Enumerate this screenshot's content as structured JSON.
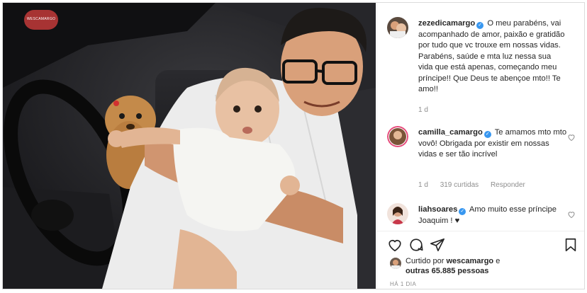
{
  "post": {
    "author": "zezedicamargo",
    "caption": "O meu parabéns, vai acompanhado de amor, paixão e gratidão por tudo que vc trouxe em nossas vidas. Parabéns, saúde e mta luz nessa sua vida que está apenas, começando meu príncipe!! Que Deus te abençoe mto!! Te amo!!",
    "age": "1 d",
    "photo_sticker": "WESCAMARGO"
  },
  "comments": [
    {
      "username": "camilla_camargo",
      "text": "Te amamos mto mto vovô! Obrigada por existir em nossas vidas e ser tão incrível",
      "age": "1 d",
      "likes": "319 curtidas",
      "reply": "Responder"
    },
    {
      "username": "liahsoares",
      "text": "Amo muito esse príncipe Joaquim ! ♥"
    }
  ],
  "likes": {
    "prefix": "Curtido por",
    "user": "wescamargo",
    "conj": "e",
    "others": "outras 65.885 pessoas"
  },
  "timestamp": "HÁ 1 DIA",
  "icons": {
    "verified": "verified-badge-icon",
    "like": "heart-icon",
    "comment": "comment-icon",
    "share": "paper-plane-icon",
    "save": "bookmark-icon"
  },
  "colors": {
    "verified": "#3897f0",
    "muted": "#8e8e8e",
    "border": "#dbdbdb"
  }
}
